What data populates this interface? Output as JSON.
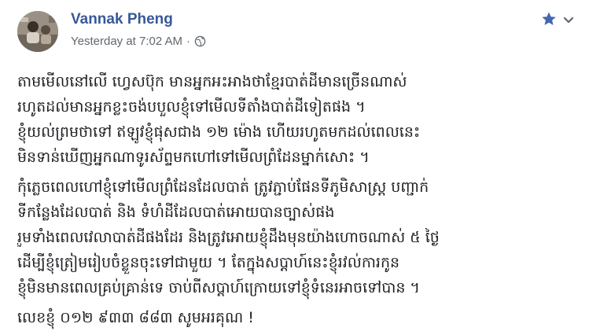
{
  "post": {
    "author": "Vannak Pheng",
    "timestamp": "Yesterday at 7:02 AM",
    "separator": "·",
    "privacy_icon": "globe-icon",
    "favorite_icon": "star-icon",
    "menu_icon": "chevron-down-icon",
    "paragraphs": [
      {
        "lines": [
          "តាមមើលនៅលើ ហ្វេសប៊ុក មានអ្នកអះអាងថាខ្មែរបាត់ដីមានច្រើនណាស់",
          "រហូតដល់មានអ្នកខ្លះចង់បបួលខ្ញុំទៅមើលទីតាំងបាត់ដីទៀតផង ។",
          "ខ្ញុំយល់ព្រមថាទៅ ឥឡូវខ្ញុំផុសជាង ១២ ម៉ោង ហើយរហូតមកដល់ពេលនេះ",
          "មិនទាន់ឃើញអ្នកណាទូរស័ព្ទមកហៅទៅមើលព្រំដែនម្នាក់សោះ ។"
        ]
      },
      {
        "lines": [
          "កុំភ្លេចពេលហៅខ្ញុំទៅមើលព្រំដែនដែលបាត់ ត្រូវភ្ជាប់ផែនទីភូមិសាស្ត្រ បញ្ជាក់",
          "ទីកន្លែងដែលបាត់ និង ទំហំដីដែលបាត់អោយបានច្បាស់ផង",
          "រួមទាំងពេលវេលាបាត់ដីផងដែរ និងត្រូវអោយខ្ញុំដឹងមុនយ៉ាងហោចណាស់ ៥ ថ្ងៃ",
          "ដើម្បីខ្ញុំត្រៀមរៀបចំខ្លួនចុះទៅជាមួយ ។ តែក្នុងសប្តាហ៍នេះខ្ញុំរវល់ការកូន",
          "ខ្ញុំមិនមានពេលគ្រប់គ្រាន់ទេ ចាប់ពីសប្តាហ៍ក្រោយទៅខ្ញុំទំនេរអាចទៅបាន ។"
        ]
      },
      {
        "lines": [
          "លេខខ្ញុំ ០១២ ៩៣៣ ៨៨៣ សូមអរគុណ !"
        ]
      }
    ]
  },
  "colors": {
    "author": "#385898",
    "meta": "#616770",
    "text": "#1c1e21",
    "icon_blue": "#4267b2",
    "icon_gray": "#606770"
  }
}
